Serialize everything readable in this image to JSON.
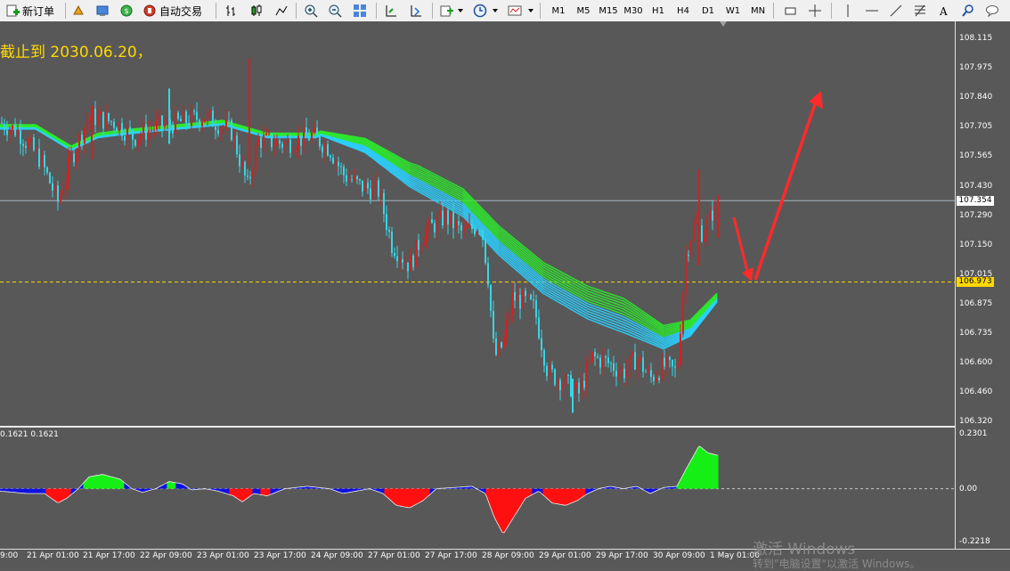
{
  "toolbar": {
    "new_order_label": "新订单",
    "auto_trading_label": "自动交易",
    "timeframes": [
      "M1",
      "M5",
      "M15",
      "M30",
      "H1",
      "H4",
      "D1",
      "W1",
      "MN"
    ]
  },
  "chart": {
    "annotation": "截止到 2030.06.20，",
    "price_ticks": [
      "108.115",
      "107.975",
      "107.840",
      "107.705",
      "107.565",
      "107.430",
      "107.290",
      "107.150",
      "107.015",
      "106.875",
      "106.735",
      "106.600",
      "106.460",
      "106.320"
    ],
    "current_price": "107.354",
    "dashed_level": "106.973",
    "time_ticks": [
      "9:00",
      "21 Apr 01:00",
      "21 Apr 17:00",
      "22 Apr 09:00",
      "23 Apr 01:00",
      "23 Apr 17:00",
      "24 Apr 09:00",
      "27 Apr 01:00",
      "27 Apr 17:00",
      "28 Apr 09:00",
      "29 Apr 01:00",
      "29 Apr 17:00",
      "30 Apr 09:00",
      "1 May 01:00"
    ],
    "colors": {
      "bull": "#d42020",
      "bear": "#36d6e6",
      "ribbon_fast": "#2bd0ff",
      "ribbon_slow": "#2ee82e",
      "arrow": "#ff2a2a",
      "dashed": "#ffd800"
    }
  },
  "indicator": {
    "label": "0.1621 0.1621",
    "ticks": [
      "0.2301",
      "0.00",
      "-0.2218"
    ]
  },
  "watermark": {
    "line1": "激活 Windows",
    "line2": "转到\"电脑设置\"以激活 Windows。"
  }
}
